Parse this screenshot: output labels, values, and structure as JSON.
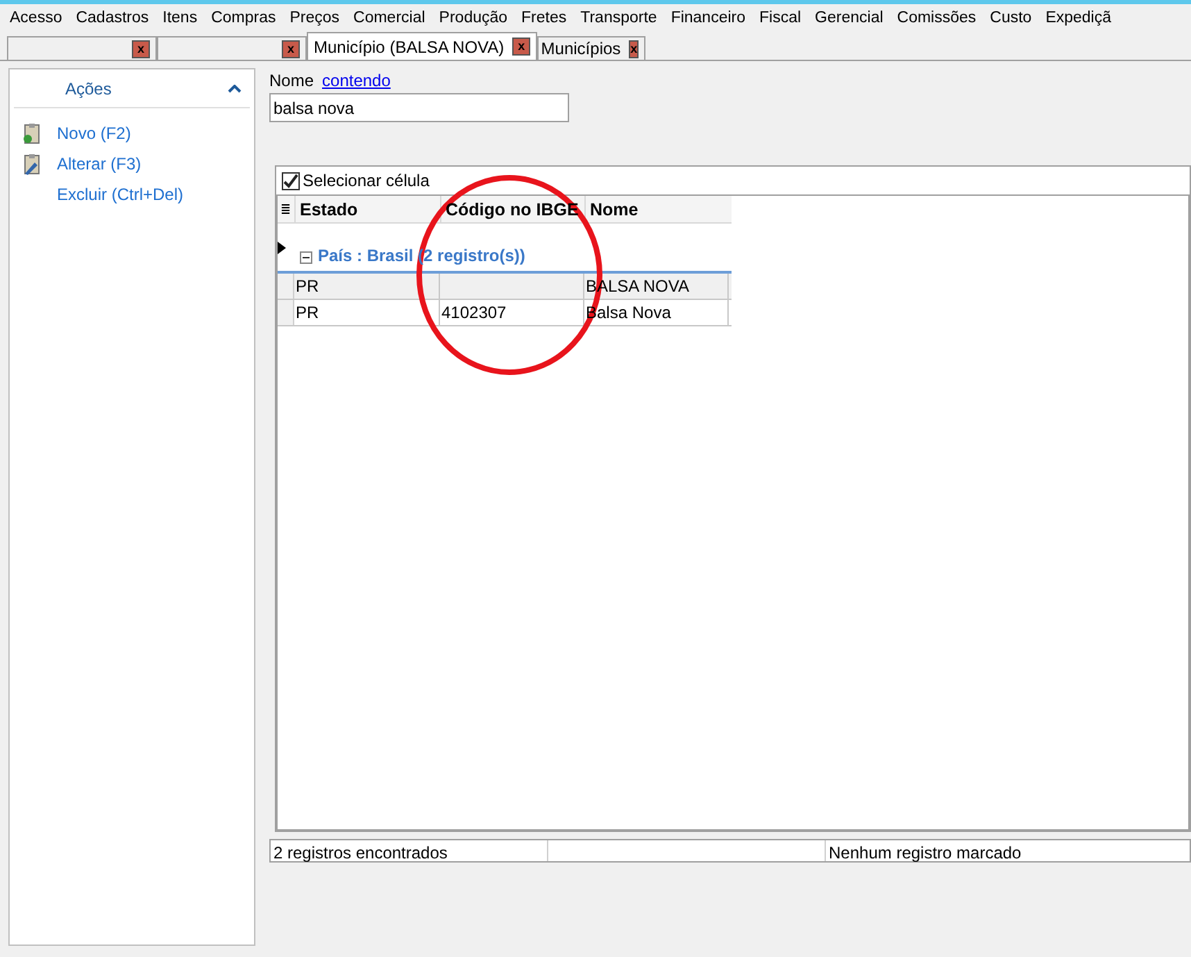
{
  "menu": [
    "Acesso",
    "Cadastros",
    "Itens",
    "Compras",
    "Preços",
    "Comercial",
    "Produção",
    "Fretes",
    "Transporte",
    "Financeiro",
    "Fiscal",
    "Gerencial",
    "Comissões",
    "Custo",
    "Expediçã"
  ],
  "tabs": [
    {
      "selected": false,
      "close": "x"
    },
    {
      "selected": false,
      "close": "x"
    },
    {
      "label": "Município (BALSA NOVA)",
      "selected": true,
      "close": "x"
    },
    {
      "label": "Municípios",
      "selected": false,
      "close": "x"
    }
  ],
  "sidebar": {
    "title": "Ações",
    "expanded": true,
    "items": [
      {
        "label": "Novo (F2)",
        "kind": "new"
      },
      {
        "label": "Alterar (F3)",
        "kind": "edit"
      },
      {
        "label": "Excluir (Ctrl+Del)",
        "kind": "plain"
      }
    ]
  },
  "filter": {
    "label": "Nome",
    "operator": "contendo",
    "value": "balsa nova"
  },
  "select_cell": {
    "label": "Selecionar célula",
    "checked": true
  },
  "table": {
    "columns": [
      "Estado",
      "Código no IBGE",
      "Nome"
    ],
    "column_options": "≣",
    "group": {
      "label": "País : Brasil (2 registro(s))",
      "expanded": true
    },
    "rows": [
      [
        "PR",
        "",
        "BALSA NOVA"
      ],
      [
        "PR",
        "4102307",
        "Balsa Nova"
      ]
    ]
  },
  "status_bar": [
    "2 registros encontrados",
    "Nenhum registro marcado"
  ]
}
